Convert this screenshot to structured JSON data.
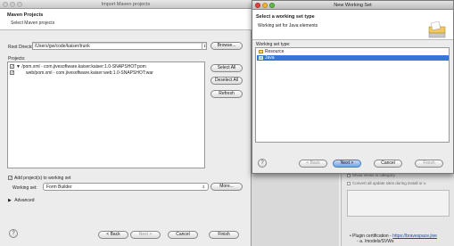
{
  "import_dialog": {
    "title": "Import Maven projects",
    "header_title": "Maven Projects",
    "header_subtitle": "Select Maven projects",
    "root_directory_label": "Root Directory:",
    "root_directory_value": "/Users/gw/code/kaiser/trunk",
    "browse_label": "Browse...",
    "projects_label": "Projects:",
    "projects": [
      {
        "checked": true,
        "label": "▼ /pom.xml - com.jivesoftware.kaiser:kaiser:1.0-SNAPSHOT:pom"
      },
      {
        "checked": true,
        "label": "web/pom.xml - com.jivesoftware.kaiser:web:1.0-SNAPSHOT:war"
      }
    ],
    "select_all_label": "Select All",
    "deselect_all_label": "Deselect All",
    "refresh_label": "Refresh",
    "add_to_working_set_label": "Add project(s) to working set",
    "add_to_working_set_checked": true,
    "working_set_label": "Working set:",
    "working_set_value": "Form Builder",
    "more_label": "More...",
    "advanced_label": "Advanced",
    "back_label": "< Back",
    "next_label": "Next >",
    "cancel_label": "Cancel",
    "finish_label": "Finish"
  },
  "new_working_set": {
    "title": "New Working Set",
    "header_title": "Select a working set type",
    "header_subtitle": "Working set for Java elements",
    "types_label": "Working set type:",
    "types": [
      {
        "label": "Resource",
        "selected": false
      },
      {
        "label": "Java",
        "selected": true
      }
    ],
    "back_label": "< Back",
    "next_label": "Next >",
    "cancel_label": "Cancel",
    "finish_label": "Finish"
  },
  "background": {
    "check1": "Show Views in category",
    "check2": "Convert all update sites during install or u",
    "bullet1_text": "Plugin certification - ",
    "bullet1_link": "https://bravespace.jive",
    "bullet2": "a. /models/SVWs"
  },
  "colors": {
    "selection": "#3875d7",
    "default_button": "#6ea5ea"
  }
}
